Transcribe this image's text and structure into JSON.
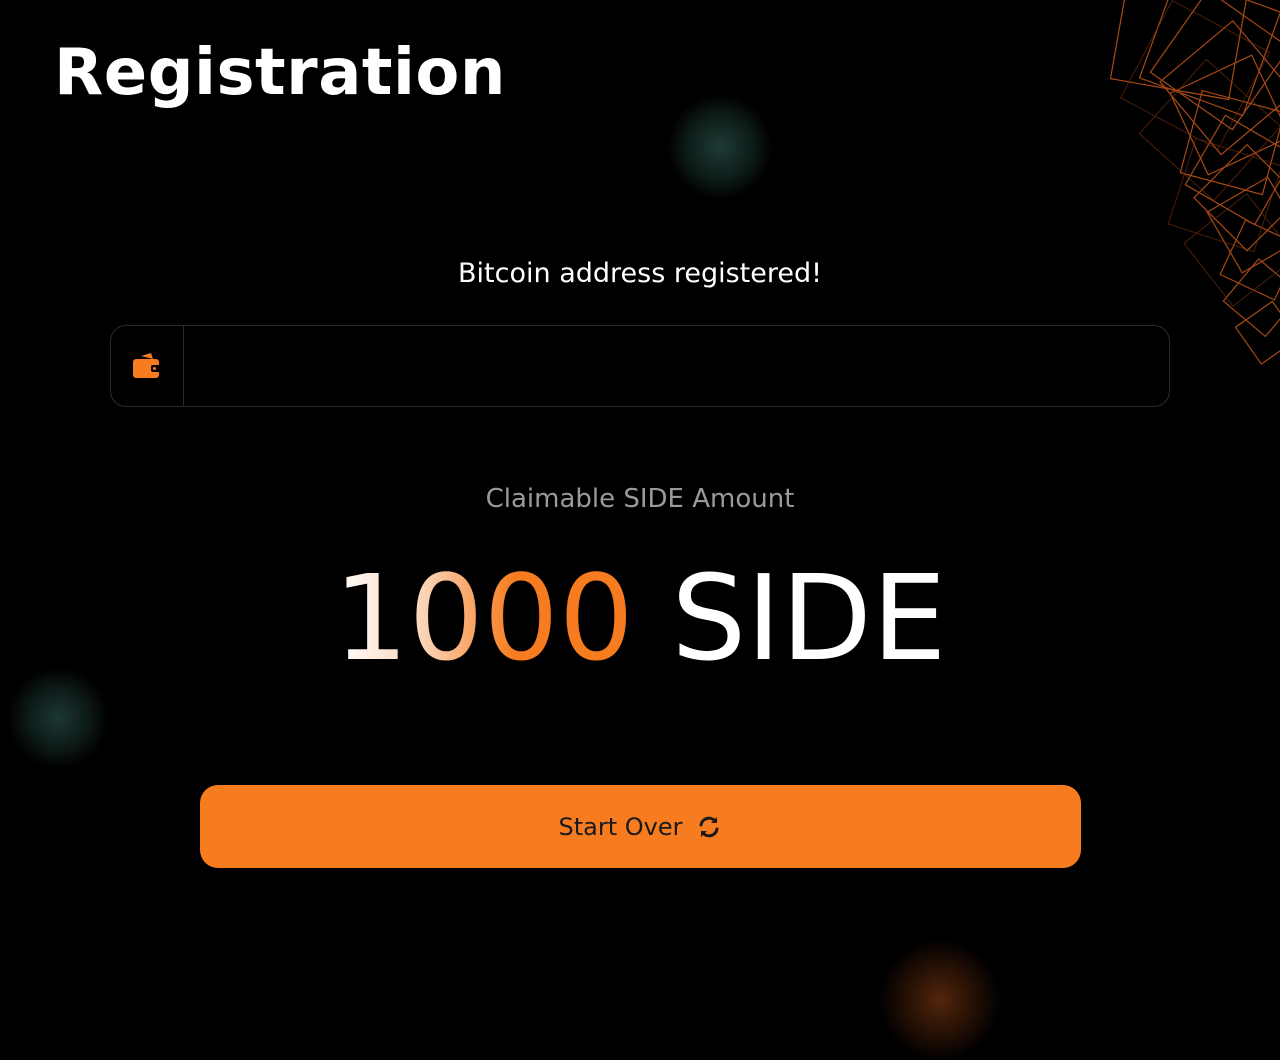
{
  "page": {
    "title": "Registration"
  },
  "status": {
    "message": "Bitcoin address registered!"
  },
  "address_field": {
    "icon": "wallet-icon",
    "value": ""
  },
  "claim": {
    "label": "Claimable SIDE Amount",
    "amount": "1000",
    "unit": "SIDE"
  },
  "actions": {
    "start_over_label": "Start Over",
    "start_over_icon": "refresh-icon"
  },
  "colors": {
    "accent": "#f77c1f",
    "background": "#000000",
    "text": "#ffffff",
    "muted": "#9a9a9a",
    "border": "#2b2b2b"
  }
}
